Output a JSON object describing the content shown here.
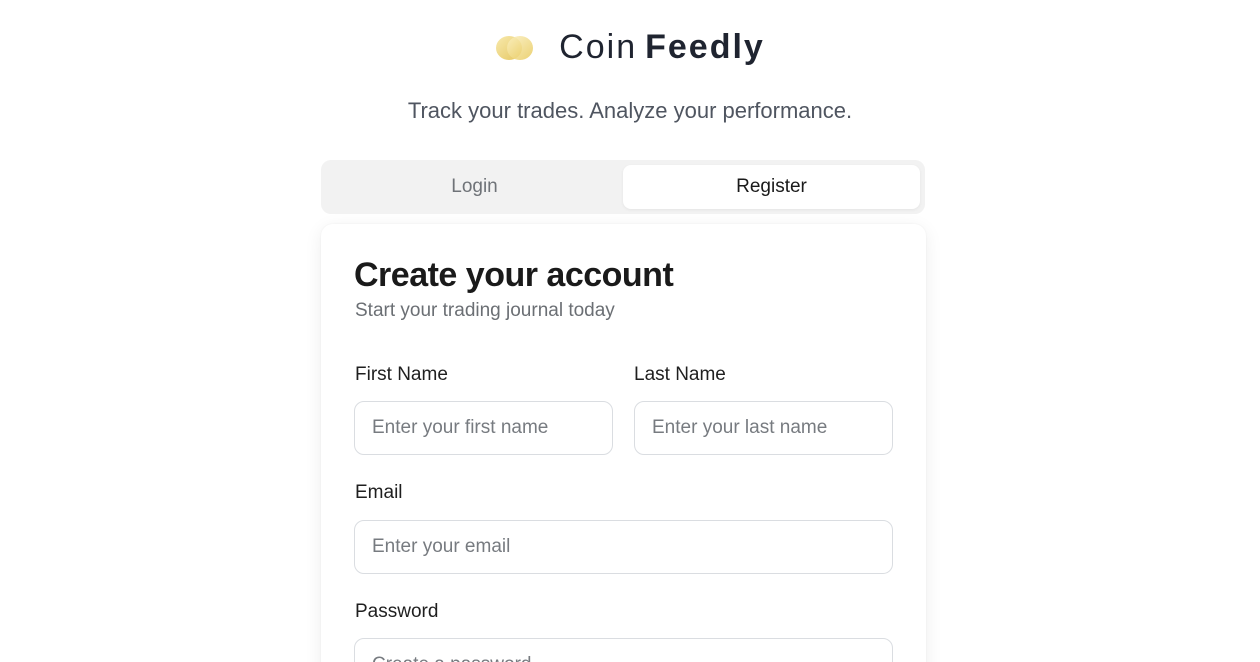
{
  "brand": {
    "logo_icon": "coin-logo-icon",
    "name_light": "Coin",
    "name_bold": "Feedly",
    "accent_color": "#e8c95a"
  },
  "tagline": "Track your trades. Analyze your performance.",
  "tabs": [
    {
      "label": "Login",
      "active": false
    },
    {
      "label": "Register",
      "active": true
    }
  ],
  "form": {
    "title": "Create your account",
    "subtitle": "Start your trading journal today",
    "first_name": {
      "label": "First Name",
      "placeholder": "Enter your first name",
      "value": ""
    },
    "last_name": {
      "label": "Last Name",
      "placeholder": "Enter your last name",
      "value": ""
    },
    "email": {
      "label": "Email",
      "placeholder": "Enter your email",
      "value": ""
    },
    "password": {
      "label": "Password",
      "placeholder": "Create a password",
      "value": ""
    }
  }
}
